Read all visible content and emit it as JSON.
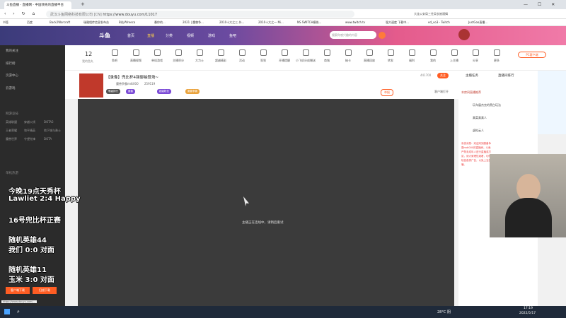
{
  "browser": {
    "tabs": [
      {
        "label": "斗鱼直播 - 直播网 - 中国领先的直播平台"
      },
      {
        "label": "+"
      }
    ],
    "url": "https://www.douyu.com/11017",
    "site_badge": "武汉斗鱼网络科技有限公司 [CN]",
    "right_tools": "大连公安局三往局长被通缉",
    "bookmarks": [
      "书签",
      "百度",
      "Back2Warcraft",
      "瑞雅相传信息发布台",
      "B站/Afreeca",
      "愚你的...",
      "2021 | 魔兽争...",
      "2010十大之三 外...",
      "2010十大之一 Mi...",
      "NS SWITCH模拟...",
      "www.twitch.tv",
      "强大速度 下载中...",
      "ed_vo3 - Twitch",
      "JustGoo直播..."
    ]
  },
  "banner": {
    "logo": "斗鱼",
    "nav": [
      "首页",
      "直播",
      "分类",
      "视频",
      "游戏",
      "鱼吧"
    ],
    "search_placeholder": "搜索你感兴趣的内容"
  },
  "sidebar": {
    "items": [
      "我的关注",
      "排行榜",
      "页游中心",
      "云游戏"
    ],
    "section1": "网游竞技",
    "section1_games": [
      "英雄联盟",
      "穿越火线",
      "王者荣耀",
      "和平精英",
      "DOTA2",
      "地下城与勇士",
      "魔兽世界",
      "守望先锋",
      "DOTA",
      "三国杀"
    ],
    "section2": "单机热游",
    "footer_buttons": [
      "客户端下载",
      "扫描下载"
    ]
  },
  "overlay": {
    "lines": [
      "今晚19点天秀杯",
      "Lawliet 2:4 Happy",
      "16号兜比杯正赛",
      "随机英雄44",
      "我们 0:0 对面",
      "随机英雄11",
      "玉米 3:0 对面"
    ]
  },
  "catbar": {
    "level": "12",
    "level_label": "我的鱼丸",
    "items": [
      "鱼吧",
      "直播视频",
      "单机游戏",
      "主播积分",
      "大力士",
      "超越精彩",
      "活动",
      "签到",
      "开播提醒",
      "小飞机分成赠送",
      "商城",
      "抽卡",
      "直播回放",
      "转发",
      "福利",
      "我的",
      "上主播",
      "分享",
      "更多"
    ],
    "pc_button": "PC客户端"
  },
  "room": {
    "title": "【录像】兜比杯4强御袖登场~",
    "host": "魔兽争霸mdt000",
    "fans": "259119",
    "tags": [
      "等级排行",
      "魔兽",
      "超级粉丝",
      "魔兽争霸"
    ],
    "followers": "441700",
    "report": "举报",
    "follow_button": "关注",
    "share": "客户端打开"
  },
  "player": {
    "loading": "主播正在连线中，请稍后重试"
  },
  "right": {
    "tabs": [
      "主播任务",
      "直播间排行"
    ],
    "rank_title": "本房间直播推荐",
    "ranks": [
      "玩车展杰克的黑白玩法",
      "真菜真真人",
      "虚拟云人"
    ],
    "system": "系统消息：欢迎来到魔兽争霸mdt000的直播间。斗鱼严禁未成年人进行直播或打赏，请大家理性观看，切勿轻信各类广告，以免上当受骗。"
  },
  "taskbar": {
    "temp": "28°C 阴",
    "time": "17:19",
    "date": "2022/5/17",
    "status_url": "https://www.douyu.com/..."
  },
  "colors": {
    "accent": "#ff5d23",
    "banner_start": "#3b3b7a",
    "banner_end": "#f07aa8"
  }
}
